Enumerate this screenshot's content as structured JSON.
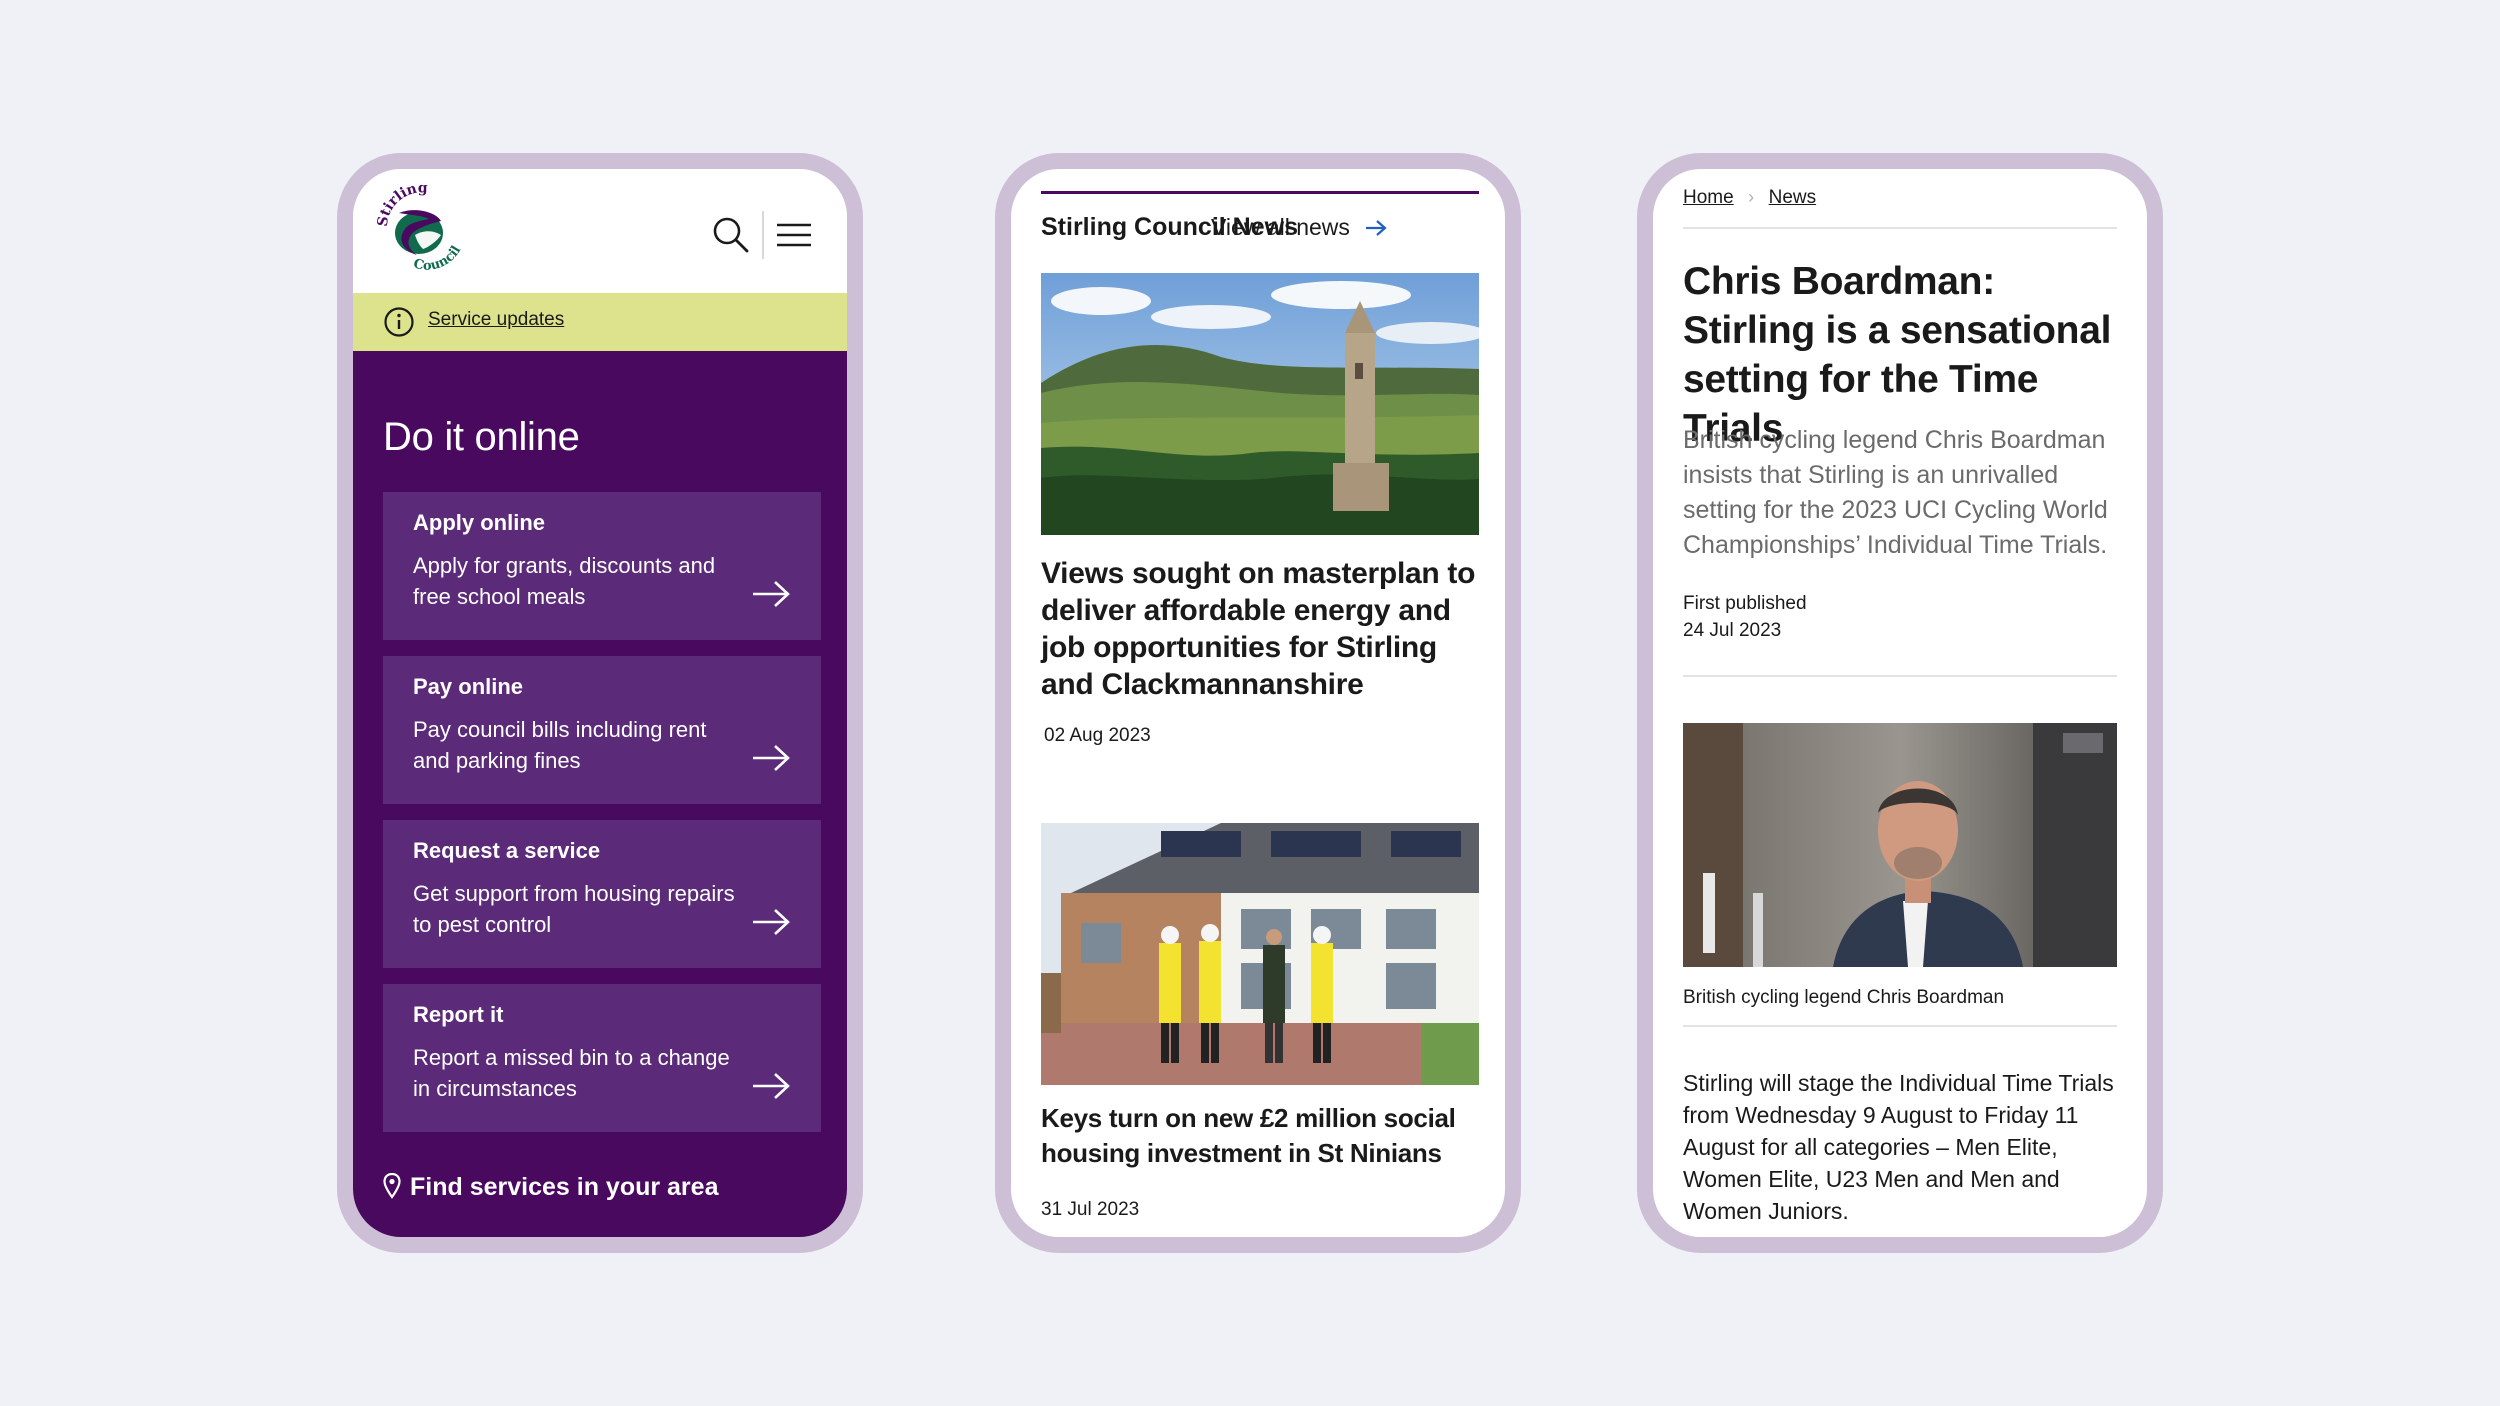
{
  "phone1": {
    "logo": {
      "top_text": "Stirling",
      "bottom_text": "Council"
    },
    "header": {
      "search_icon": "search-icon",
      "menu_icon": "hamburger-menu-icon"
    },
    "service_updates": {
      "icon": "info-icon",
      "label": "Service updates"
    },
    "main": {
      "title": "Do it online",
      "cards": [
        {
          "title": "Apply online",
          "desc": "Apply for grants, discounts and free school meals"
        },
        {
          "title": "Pay online",
          "desc": "Pay council bills including rent and parking fines"
        },
        {
          "title": "Request a service",
          "desc": "Get support from housing repairs to pest control"
        },
        {
          "title": "Report it",
          "desc": "Report a missed bin to a change in circumstances"
        }
      ],
      "find_services": {
        "icon": "map-pin-icon",
        "label": "Find services in your area"
      }
    },
    "colors": {
      "purple_dark": "#48095f",
      "purple_card": "#5b2a78",
      "banner_yellow": "#dde38c"
    }
  },
  "phone2": {
    "heading": "Stirling Council News",
    "view_all": "View all news",
    "articles": [
      {
        "title": "Views sought on masterplan to deliver affordable energy and job opportunities for Stirling and Clackmannanshire",
        "date": "02 Aug 2023"
      },
      {
        "title": "Keys turn on new £2 million social housing investment in St Ninians",
        "date": "31 Jul 2023"
      }
    ]
  },
  "phone3": {
    "breadcrumbs": [
      "Home",
      "News"
    ],
    "title": "Chris Boardman: Stirling is a sensational setting for the Time Trials",
    "intro": "British cycling legend Chris Boardman insists that Stirling is an unrivalled setting for the 2023 UCI Cycling World Championships’ Individual Time Trials.",
    "meta_label": "First published",
    "meta_date": "24 Jul 2023",
    "caption": "British cycling legend Chris Boardman",
    "body": "Stirling will stage the Individual Time Trials from Wednesday 9 August to Friday 11 August for all categories – Men Elite, Women Elite, U23 Men and Men and Women Juniors."
  }
}
